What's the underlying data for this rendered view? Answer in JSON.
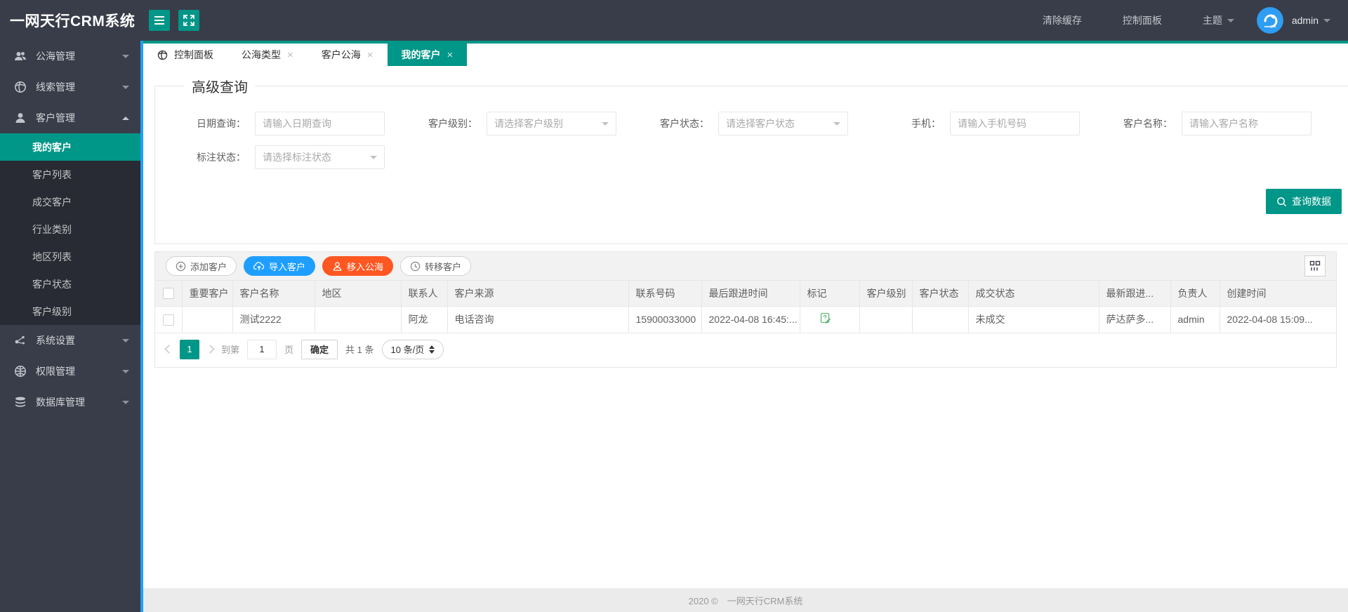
{
  "colors": {
    "accent": "#009688",
    "blue": "#1E9FFF",
    "orange": "#FF5722",
    "dark_bg": "#393D49",
    "divider_blue": "#1E9FFF"
  },
  "topbar": {
    "app_title": "一网天行CRM系统",
    "clear_cache": "清除缓存",
    "control_panel": "控制面板",
    "theme": "主题",
    "username": "admin"
  },
  "sidebar": {
    "items": [
      {
        "label": "公海管理",
        "icon": "users-icon"
      },
      {
        "label": "线索管理",
        "icon": "globe-icon"
      },
      {
        "label": "客户管理",
        "icon": "user-icon"
      },
      {
        "label": "系统设置",
        "icon": "share-icon"
      },
      {
        "label": "权限管理",
        "icon": "web-icon"
      },
      {
        "label": "数据库管理",
        "icon": "database-icon"
      }
    ],
    "customer_children": [
      {
        "label": "我的客户",
        "active": true
      },
      {
        "label": "客户列表"
      },
      {
        "label": "成交客户"
      },
      {
        "label": "行业类别"
      },
      {
        "label": "地区列表"
      },
      {
        "label": "客户状态"
      },
      {
        "label": "客户级别"
      }
    ]
  },
  "tabs": [
    {
      "label": "控制面板",
      "closable": false,
      "active": false
    },
    {
      "label": "公海类型",
      "closable": true,
      "active": false
    },
    {
      "label": "客户公海",
      "closable": true,
      "active": false
    },
    {
      "label": "我的客户",
      "closable": true,
      "active": true
    }
  ],
  "query": {
    "legend": "高级查询",
    "fields": [
      {
        "label": "日期查询：",
        "placeholder": "请输入日期查询",
        "type": "input"
      },
      {
        "label": "客户级别：",
        "placeholder": "请选择客户级别",
        "type": "select"
      },
      {
        "label": "客户状态：",
        "placeholder": "请选择客户状态",
        "type": "select"
      },
      {
        "label": "手机：",
        "placeholder": "请输入手机号码",
        "type": "input"
      },
      {
        "label": "客户名称：",
        "placeholder": "请输入客户名称",
        "type": "input"
      },
      {
        "label": "标注状态：",
        "placeholder": "请选择标注状态",
        "type": "select"
      }
    ],
    "submit": "查询数据"
  },
  "toolbar": {
    "add": "添加客户",
    "import": "导入客户",
    "move": "移入公海",
    "transfer": "转移客户"
  },
  "table": {
    "columns": [
      "重要客户",
      "客户名称",
      "地区",
      "联系人",
      "客户来源",
      "联系号码",
      "最后跟进时间",
      "标记",
      "客户级别",
      "客户状态",
      "成交状态",
      "最新跟进...",
      "负责人",
      "创建时间"
    ],
    "row": {
      "important": "",
      "name": "测试2222",
      "region": "",
      "contact": "阿龙",
      "source": "电话咨询",
      "phone": "15900033000",
      "last_follow": "2022-04-08 16:45:...",
      "mark_icon": "mark-edit-icon",
      "level": "",
      "status": "",
      "deal_status": "未成交",
      "latest_follow": "萨达萨多...",
      "owner": "admin",
      "created": "2022-04-08 15:09..."
    }
  },
  "pagination": {
    "page": "1",
    "goto_prefix": "到第",
    "goto_value": "1",
    "goto_suffix": "页",
    "confirm": "确定",
    "total": "共 1 条",
    "page_size": "10 条/页"
  },
  "footer": {
    "text": "2020 ©　一网天行CRM系统"
  }
}
